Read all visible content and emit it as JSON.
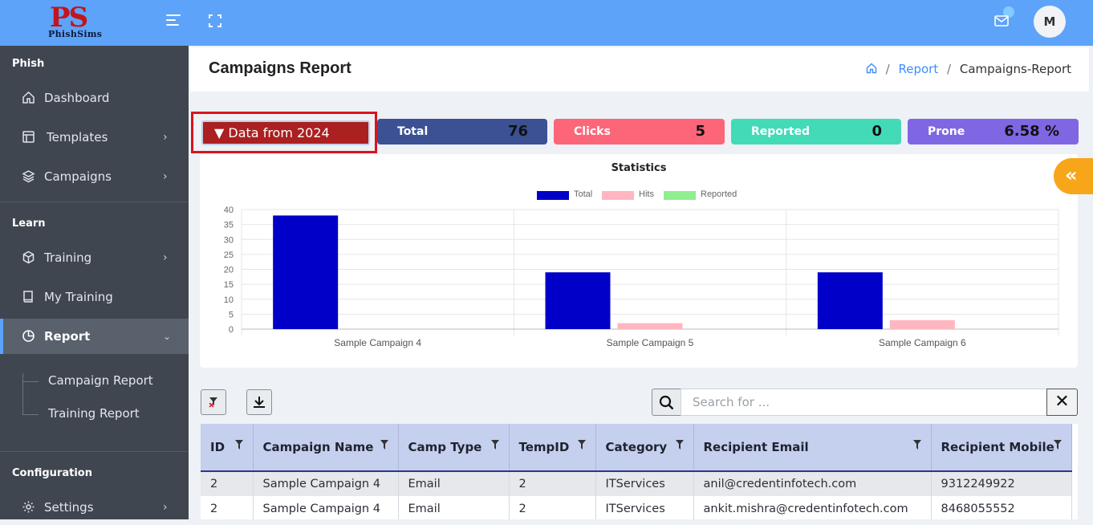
{
  "app": {
    "logo_main": "PS",
    "logo_sub": "PhishSims",
    "avatar_initial": "M"
  },
  "sidebar": {
    "sections": [
      {
        "title": "Phish",
        "items": [
          {
            "label": "Dashboard",
            "icon": "home-icon",
            "chevron": false
          },
          {
            "label": "Templates",
            "icon": "layout-icon",
            "chevron": true
          },
          {
            "label": "Campaigns",
            "icon": "layers-icon",
            "chevron": true
          }
        ]
      },
      {
        "title": "Learn",
        "items": [
          {
            "label": "Training",
            "icon": "cube-icon",
            "chevron": true
          },
          {
            "label": "My Training",
            "icon": "book-icon",
            "chevron": false
          },
          {
            "label": "Report",
            "icon": "pie-chart-icon",
            "chevron": true,
            "active": true
          }
        ]
      },
      {
        "title": "Configuration",
        "items": [
          {
            "label": "Settings",
            "icon": "gear-icon",
            "chevron": true
          }
        ]
      }
    ],
    "report_sub": [
      "Campaign Report",
      "Training Report"
    ]
  },
  "header": {
    "title": "Campaigns Report",
    "breadcrumb": {
      "link": "Report",
      "current": "Campaigns-Report"
    }
  },
  "filter": {
    "year_label": "▼ Data from 2024"
  },
  "stats": [
    {
      "label": "Total",
      "value": "76",
      "color": "#3b5193"
    },
    {
      "label": "Clicks",
      "value": "5",
      "color": "#fd6679"
    },
    {
      "label": "Reported",
      "value": "0",
      "color": "#43dab8"
    },
    {
      "label": "Prone",
      "value": "6.58 %",
      "color": "#7f67e4"
    }
  ],
  "chart_data": {
    "type": "bar",
    "title": "Statistics",
    "categories": [
      "Sample Campaign 4",
      "Sample Campaign 5",
      "Sample Campaign 6"
    ],
    "series": [
      {
        "name": "Total",
        "values": [
          38,
          19,
          19
        ],
        "color": "#0000c8"
      },
      {
        "name": "Hits",
        "values": [
          0,
          2,
          3
        ],
        "color": "#ffb6c1"
      },
      {
        "name": "Reported",
        "values": [
          0,
          0,
          0
        ],
        "color": "#90ee90"
      }
    ],
    "ylim": [
      0,
      40
    ],
    "yticks": [
      0,
      5,
      10,
      15,
      20,
      25,
      30,
      35,
      40
    ],
    "grid": true,
    "legend": "top"
  },
  "table": {
    "search_placeholder": "Search for ...",
    "columns": [
      "ID",
      "Campaign Name",
      "Camp Type",
      "TempID",
      "Category",
      "Recipient Email",
      "Recipient Mobile"
    ],
    "rows": [
      [
        "2",
        "Sample Campaign 4",
        "Email",
        "2",
        "ITServices",
        "anil@credentinfotech.com",
        "9312249922"
      ],
      [
        "2",
        "Sample Campaign 4",
        "Email",
        "2",
        "ITServices",
        "ankit.mishra@credentinfotech.com",
        "8468055552"
      ]
    ]
  }
}
